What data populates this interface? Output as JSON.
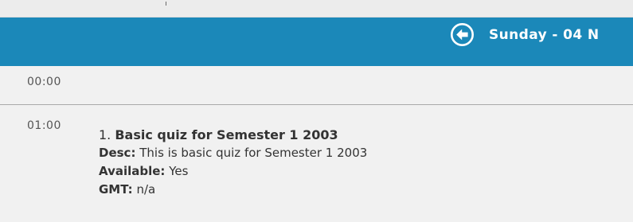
{
  "header": {
    "day_title": "Sunday - 04 N",
    "nav_icon": "circle-arrow-left-icon",
    "bar_color": "#1b88b9"
  },
  "slots": [
    {
      "time": "00:00"
    },
    {
      "time": "01:00",
      "event": {
        "number": "1.",
        "title": "Basic quiz for Semester 1 2003",
        "desc_label": "Desc:",
        "desc_value": "This is basic quiz for Semester 1 2003",
        "available_label": "Available:",
        "available_value": "Yes",
        "gmt_label": "GMT:",
        "gmt_value": "n/a"
      }
    }
  ]
}
